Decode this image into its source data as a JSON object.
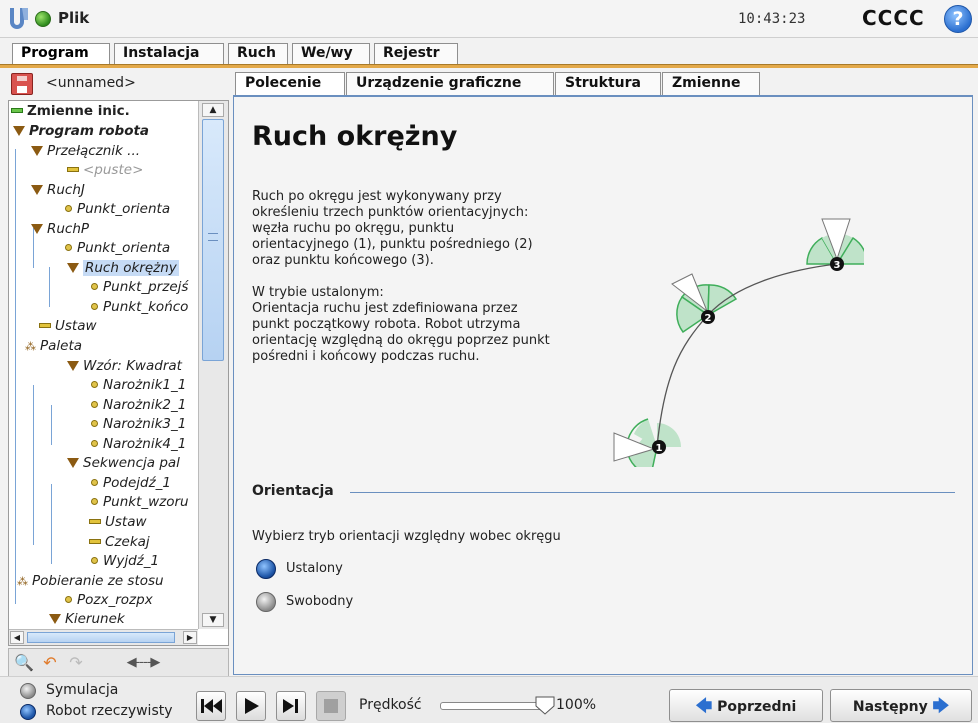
{
  "header": {
    "app_title": "Plik",
    "clock": "10:43:23",
    "robot_name": "CCCC",
    "help_label": "?"
  },
  "main_tabs": [
    {
      "label": "Program",
      "active": true
    },
    {
      "label": "Instalacja",
      "active": false
    },
    {
      "label": "Ruch",
      "active": false
    },
    {
      "label": "We/wy",
      "active": false
    },
    {
      "label": "Rejestr",
      "active": false
    }
  ],
  "program": {
    "name": "<unnamed>",
    "tree": [
      {
        "label": "Zmienne inic.",
        "icon": "variables-icon"
      },
      {
        "label": "Program robota",
        "icon": "folder-triangle-icon"
      },
      {
        "label": "Przełącznik ...",
        "icon": "folder-triangle-icon"
      },
      {
        "label": "<puste>",
        "icon": "empty-command-icon"
      },
      {
        "label": "RuchJ",
        "icon": "folder-triangle-icon"
      },
      {
        "label": "Punkt_orienta",
        "icon": "waypoint-icon"
      },
      {
        "label": "RuchP",
        "icon": "folder-triangle-icon"
      },
      {
        "label": "Punkt_orienta",
        "icon": "waypoint-icon"
      },
      {
        "label": "Ruch okrężny",
        "icon": "folder-triangle-icon"
      },
      {
        "label": "Punkt_przejś",
        "icon": "waypoint-icon"
      },
      {
        "label": "Punkt_końco",
        "icon": "waypoint-icon"
      },
      {
        "label": "Ustaw",
        "icon": "set-command-icon"
      },
      {
        "label": "Paleta",
        "icon": "pallet-icon"
      },
      {
        "label": "Wzór: Kwadrat",
        "icon": "folder-triangle-icon"
      },
      {
        "label": "Narożnik1_1",
        "icon": "waypoint-icon"
      },
      {
        "label": "Narożnik2_1",
        "icon": "waypoint-icon"
      },
      {
        "label": "Narożnik3_1",
        "icon": "waypoint-icon"
      },
      {
        "label": "Narożnik4_1",
        "icon": "waypoint-icon"
      },
      {
        "label": "Sekwencja pal",
        "icon": "folder-triangle-icon"
      },
      {
        "label": "Podejdź_1",
        "icon": "waypoint-icon"
      },
      {
        "label": "Punkt_wzoru",
        "icon": "waypoint-icon"
      },
      {
        "label": "Ustaw",
        "icon": "set-command-icon"
      },
      {
        "label": "Czekaj",
        "icon": "wait-command-icon"
      },
      {
        "label": "Wyjdź_1",
        "icon": "waypoint-icon"
      },
      {
        "label": "Pobieranie ze stosu",
        "icon": "pallet-icon"
      },
      {
        "label": "Pozx_rozpx",
        "icon": "waypoint-icon"
      },
      {
        "label": "Kierunek",
        "icon": "folder-triangle-icon"
      }
    ],
    "toolbar_arrow": "◀----▶"
  },
  "sub_tabs": [
    {
      "label": "Polecenie",
      "active": true
    },
    {
      "label": "Urządzenie graficzne",
      "active": false
    },
    {
      "label": "Struktura",
      "active": false
    },
    {
      "label": "Zmienne",
      "active": false
    }
  ],
  "command": {
    "title": "Ruch okrężny",
    "description_1": "Ruch po okręgu jest wykonywany przy\nokreśleniu trzech punktów orientacyjnych:\nwęzła ruchu po okręgu, punktu\norientacyjnego (1), punktu pośredniego (2)\noraz punktu końcowego (3).",
    "description_2": "W trybie ustalonym:\nOrientacja ruchu jest zdefiniowana przez\npunkt początkowy robota. Robot utrzyma\norientację względną do okręgu poprzez punkt\npośredni i końcowy podczas ruchu.",
    "diagram_points": [
      "1",
      "2",
      "3"
    ],
    "orientation_section": "Orientacja",
    "orientation_prompt": "Wybierz tryb orientacji względny wobec okręgu",
    "options": [
      {
        "label": "Ustalony",
        "selected": true
      },
      {
        "label": "Swobodny",
        "selected": false
      }
    ]
  },
  "footer": {
    "modes": [
      {
        "label": "Symulacja",
        "selected": false
      },
      {
        "label": "Robot rzeczywisty",
        "selected": true
      }
    ],
    "speed_label": "Prędkość",
    "speed_value": "100%",
    "speed_fraction": 1.0,
    "prev_label": "Poprzedni",
    "next_label": "Następny"
  },
  "colors": {
    "accent_blue": "#2b6fd0",
    "tab_band": "#e3a94a",
    "selection": "#c6dbf5",
    "arc_fill": "#bfe3c9"
  }
}
